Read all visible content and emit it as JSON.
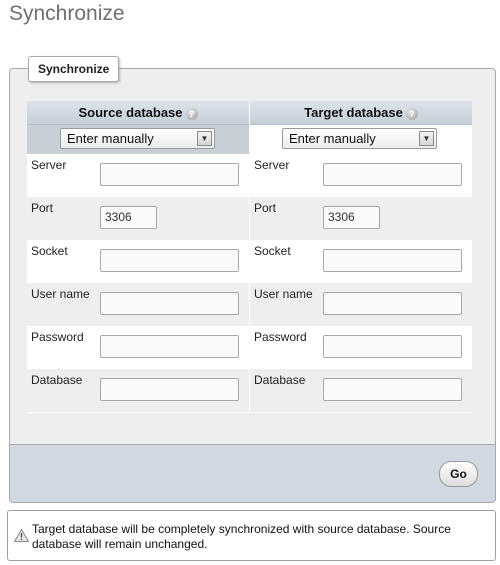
{
  "page": {
    "title": "Synchronize"
  },
  "fieldset": {
    "legend": "Synchronize"
  },
  "source": {
    "header": "Source database",
    "mode": "Enter manually",
    "fields": [
      {
        "label": "Server",
        "value": ""
      },
      {
        "label": "Port",
        "value": "3306"
      },
      {
        "label": "Socket",
        "value": ""
      },
      {
        "label": "User name",
        "value": ""
      },
      {
        "label": "Password",
        "value": ""
      },
      {
        "label": "Database",
        "value": ""
      }
    ]
  },
  "target": {
    "header": "Target database",
    "mode": "Enter manually",
    "fields": [
      {
        "label": "Server",
        "value": ""
      },
      {
        "label": "Port",
        "value": "3306"
      },
      {
        "label": "Socket",
        "value": ""
      },
      {
        "label": "User name",
        "value": ""
      },
      {
        "label": "Password",
        "value": ""
      },
      {
        "label": "Database",
        "value": ""
      }
    ]
  },
  "actions": {
    "go_label": "Go"
  },
  "notice": {
    "text": "Target database will be completely synchronized with source database. Source database will remain unchanged.",
    "icon": "warning-icon"
  },
  "colors": {
    "header_bar": "#c6ced8",
    "bottom_bar": "#d1d8e2",
    "panel_bg": "#eeeeee"
  }
}
